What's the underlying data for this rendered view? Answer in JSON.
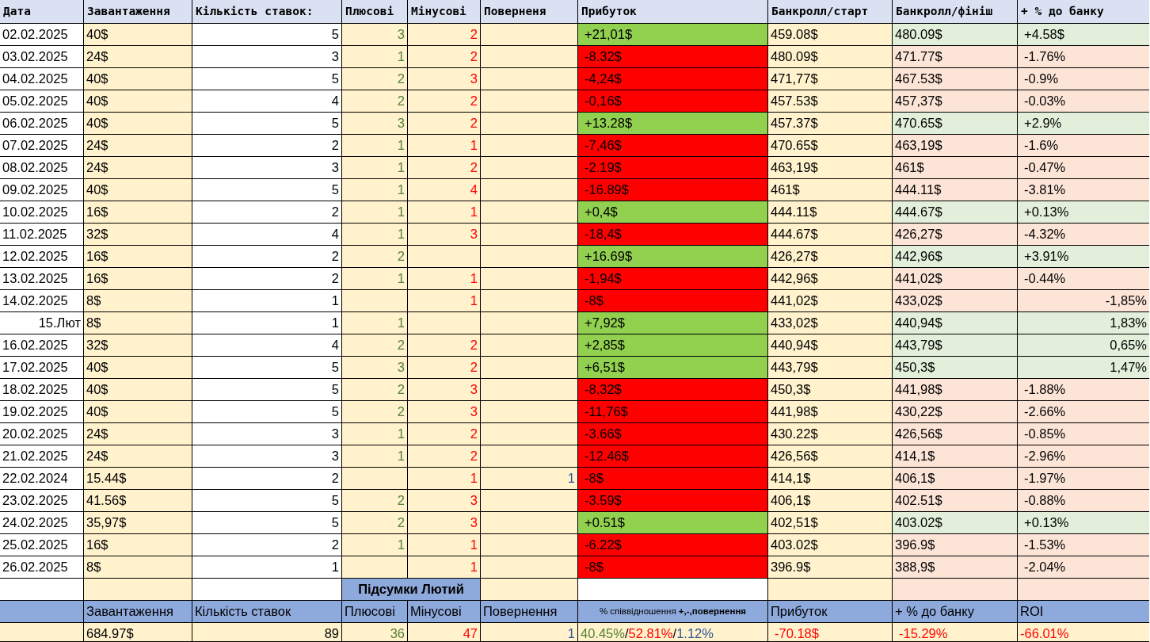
{
  "columns": [
    "Дата",
    "Завантаження",
    "Кількість ставок:",
    "Плюсові",
    "Мінусові",
    "Поверненя",
    "Прибуток",
    "Банкролл/старт",
    "Банкролл/фініш",
    "+ % до банку"
  ],
  "rows": [
    {
      "date": "02.02.2025",
      "date_numeric": false,
      "stake": "40$",
      "bets": "5",
      "plus": "3",
      "minus": "2",
      "profit": "+21,01$",
      "win": true,
      "bank_start": "459.08$",
      "bank_finish": "480.09$",
      "bank_change": "+4.58$",
      "change_numeric": false
    },
    {
      "date": "03.02.2025",
      "date_numeric": false,
      "stake": "24$",
      "bets": "3",
      "plus": "1",
      "minus": "2",
      "profit": "-8.32$",
      "win": false,
      "bank_start": "480.09$",
      "bank_finish": "471.77$",
      "bank_change": "-1.76%",
      "change_numeric": false
    },
    {
      "date": "04.02.2025",
      "date_numeric": false,
      "stake": "40$",
      "bets": "5",
      "plus": "2",
      "minus": "3",
      "profit": "-4,24$",
      "win": false,
      "bank_start": "471,77$",
      "bank_finish": "467.53$",
      "bank_change": "-0.9%",
      "change_numeric": false
    },
    {
      "date": "05.02.2025",
      "date_numeric": false,
      "stake": "40$",
      "bets": "4",
      "plus": "2",
      "minus": "2",
      "profit": "-0,16$",
      "win": false,
      "bank_start": "457.53$",
      "bank_finish": "457,37$",
      "bank_change": "-0.03%",
      "change_numeric": false
    },
    {
      "date": "06.02.2025",
      "date_numeric": false,
      "stake": "40$",
      "bets": "5",
      "plus": "3",
      "minus": "2",
      "profit": "+13.28$",
      "win": true,
      "bank_start": "457.37$",
      "bank_finish": "470.65$",
      "bank_change": "+2.9%",
      "change_numeric": false
    },
    {
      "date": "07.02.2025",
      "date_numeric": false,
      "stake": "24$",
      "bets": "2",
      "plus": "1",
      "minus": "1",
      "profit": "-7,46$",
      "win": false,
      "bank_start": "470.65$",
      "bank_finish": "463,19$",
      "bank_change": "-1.6%",
      "change_numeric": false
    },
    {
      "date": "08.02.2025",
      "date_numeric": false,
      "stake": "24$",
      "bets": "3",
      "plus": "1",
      "minus": "2",
      "profit": "-2.19$",
      "win": false,
      "bank_start": "463,19$",
      "bank_finish": "461$",
      "bank_change": "-0.47%",
      "change_numeric": false
    },
    {
      "date": "09.02.2025",
      "date_numeric": false,
      "stake": "40$",
      "bets": "5",
      "plus": "1",
      "minus": "4",
      "profit": "-16.89$",
      "win": false,
      "bank_start": "461$",
      "bank_finish": "444.11$",
      "bank_change": "-3.81%",
      "change_numeric": false
    },
    {
      "date": "10.02.2025",
      "date_numeric": false,
      "stake": "16$",
      "bets": "2",
      "plus": "1",
      "minus": "1",
      "profit": "+0,4$",
      "win": true,
      "bank_start": "444.11$",
      "bank_finish": "444.67$",
      "bank_change": "+0.13%",
      "change_numeric": false
    },
    {
      "date": "11.02.2025",
      "date_numeric": false,
      "stake": "32$",
      "bets": "4",
      "plus": "1",
      "minus": "3",
      "profit": "-18,4$",
      "win": false,
      "bank_start": "444.67$",
      "bank_finish": "426,27$",
      "bank_change": "-4.32%",
      "change_numeric": false
    },
    {
      "date": "12.02.2025",
      "date_numeric": false,
      "stake": "16$",
      "bets": "2",
      "plus": "2",
      "profit": "+16.69$",
      "win": true,
      "bank_start": "426,27$",
      "bank_finish": "442,96$",
      "bank_change": "+3.91%",
      "change_numeric": false
    },
    {
      "date": "13.02.2025",
      "date_numeric": false,
      "stake": "16$",
      "bets": "2",
      "plus": "1",
      "minus": "1",
      "profit": "-1,94$",
      "win": false,
      "bank_start": "442,96$",
      "bank_finish": "441,02$",
      "bank_change": "-0.44%",
      "change_numeric": false
    },
    {
      "date": "14.02.2025",
      "date_numeric": false,
      "stake": "8$",
      "bets": "1",
      "minus": "1",
      "profit": "-8$",
      "win": false,
      "bank_start": "441,02$",
      "bank_finish": "433,02$",
      "bank_change": "-1,85%",
      "change_numeric": true
    },
    {
      "date": "15.Лют",
      "date_numeric": true,
      "stake": "8$",
      "bets": "1",
      "plus": "1",
      "profit": "+7,92$",
      "win": true,
      "bank_start": "433,02$",
      "bank_finish": "440,94$",
      "bank_change": "1,83%",
      "change_numeric": true
    },
    {
      "date": "16.02.2025",
      "date_numeric": false,
      "stake": "32$",
      "bets": "4",
      "plus": "2",
      "minus": "2",
      "profit": "+2,85$",
      "win": true,
      "bank_start": "440,94$",
      "bank_finish": "443,79$",
      "bank_change": "0,65%",
      "change_numeric": true
    },
    {
      "date": "17.02.2025",
      "date_numeric": false,
      "stake": "40$",
      "bets": "5",
      "plus": "3",
      "minus": "2",
      "profit": "+6,51$",
      "win": true,
      "bank_start": "443,79$",
      "bank_finish": "450,3$",
      "bank_change": "1,47%",
      "change_numeric": true
    },
    {
      "date": "18.02.2025",
      "date_numeric": false,
      "stake": "40$",
      "bets": "5",
      "plus": "2",
      "minus": "3",
      "profit": "-8,32$",
      "win": false,
      "bank_start": "450,3$",
      "bank_finish": "441,98$",
      "bank_change": "-1.88%",
      "change_numeric": false
    },
    {
      "date": "19.02.2025",
      "date_numeric": false,
      "stake": "40$",
      "bets": "5",
      "plus": "2",
      "minus": "3",
      "profit": "-11,76$",
      "win": false,
      "bank_start": "441,98$",
      "bank_finish": "430,22$",
      "bank_change": "-2.66%",
      "change_numeric": false
    },
    {
      "date": "20.02.2025",
      "date_numeric": false,
      "stake": "24$",
      "bets": "3",
      "plus": "1",
      "minus": "2",
      "profit": "-3.66$",
      "win": false,
      "bank_start": "430.22$",
      "bank_finish": "426,56$",
      "bank_change": "-0.85%",
      "change_numeric": false
    },
    {
      "date": "21.02.2025",
      "date_numeric": false,
      "stake": "24$",
      "bets": "3",
      "plus": "1",
      "minus": "2",
      "profit": "-12.46$",
      "win": false,
      "bank_start": "426,56$",
      "bank_finish": "414,1$",
      "bank_change": "-2.96%",
      "change_numeric": false
    },
    {
      "date": "22.02.2024",
      "date_numeric": false,
      "stake": "15.44$",
      "bets": "2",
      "minus": "1",
      "returns": "1",
      "profit": "-8$",
      "win": false,
      "bank_start": "414,1$",
      "bank_finish": "406,1$",
      "bank_change": "-1.97%",
      "change_numeric": false
    },
    {
      "date": "23.02.2025",
      "date_numeric": false,
      "stake": "41.56$",
      "bets": "5",
      "plus": "2",
      "minus": "3",
      "profit": "-3.59$",
      "win": false,
      "bank_start": "406,1$",
      "bank_finish": "402.51$",
      "bank_change": "-0.88%",
      "change_numeric": false
    },
    {
      "date": "24.02.2025",
      "date_numeric": false,
      "stake": "35,97$",
      "bets": "5",
      "plus": "2",
      "minus": "3",
      "profit": "+0.51$",
      "win": true,
      "bank_start": "402,51$",
      "bank_finish": "403.02$",
      "bank_change": "+0.13%",
      "change_numeric": false
    },
    {
      "date": "25.02.2025",
      "date_numeric": false,
      "stake": "16$",
      "bets": "2",
      "plus": "1",
      "minus": "1",
      "profit": "-6.22$",
      "win": false,
      "bank_start": "403.02$",
      "bank_finish": "396.9$",
      "bank_change": "-1.53%",
      "change_numeric": false
    },
    {
      "date": "26.02.2025",
      "date_numeric": false,
      "stake": "8$",
      "bets": "1",
      "minus": "1",
      "profit": "-8$",
      "win": false,
      "bank_start": "396.9$",
      "bank_finish": "388,9$",
      "bank_change": "-2.04%",
      "change_numeric": false
    }
  ],
  "summary": {
    "title": "Підсумки Лютий",
    "headers": [
      "Завантаження",
      "Кількість ставок",
      "Плюсові",
      "Мінусові",
      "Повернення",
      "% співвідношення **+,-,повернення**",
      "Прибуток",
      "+ % до банку",
      "ROI"
    ],
    "stake": "684.97$",
    "bets": "89",
    "plus": "36",
    "minus": "47",
    "returns": "1",
    "ratio": [
      {
        "text": "40.45%",
        "kind": "plus"
      },
      {
        "text": "/",
        "kind": "sep"
      },
      {
        "text": "52.81%",
        "kind": "minus"
      },
      {
        "text": "/",
        "kind": "sep"
      },
      {
        "text": "1.12%",
        "kind": "returns"
      }
    ],
    "profit": "-70.18$",
    "bank_change": "-15.29%",
    "roi": "-66.01%"
  }
}
